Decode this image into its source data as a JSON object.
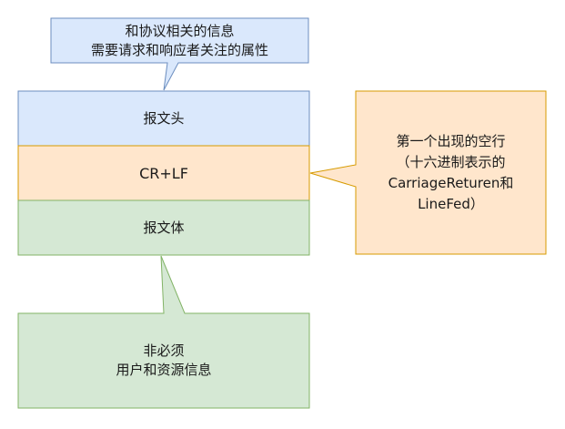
{
  "callout_top": {
    "line1": "和协议相关的信息",
    "line2": "需要请求和响应者关注的属性",
    "fill": "#dae8fc",
    "stroke": "#6c8ebf"
  },
  "block_header": {
    "label": "报文头",
    "fill": "#dae8fc",
    "stroke": "#6c8ebf"
  },
  "block_crlf": {
    "label": "CR+LF",
    "fill": "#ffe6cc",
    "stroke": "#d79b00"
  },
  "block_body": {
    "label": "报文体",
    "fill": "#d5e8d4",
    "stroke": "#82b366"
  },
  "callout_right": {
    "line1": "第一个出现的空行",
    "line2": "（十六进制表示的",
    "line3": "CarriageReturen和",
    "line4": "LineFed）",
    "fill": "#ffe6cc",
    "stroke": "#d79b00"
  },
  "callout_bottom": {
    "line1": "非必须",
    "line2": "用户和资源信息",
    "fill": "#d5e8d4",
    "stroke": "#82b366"
  }
}
